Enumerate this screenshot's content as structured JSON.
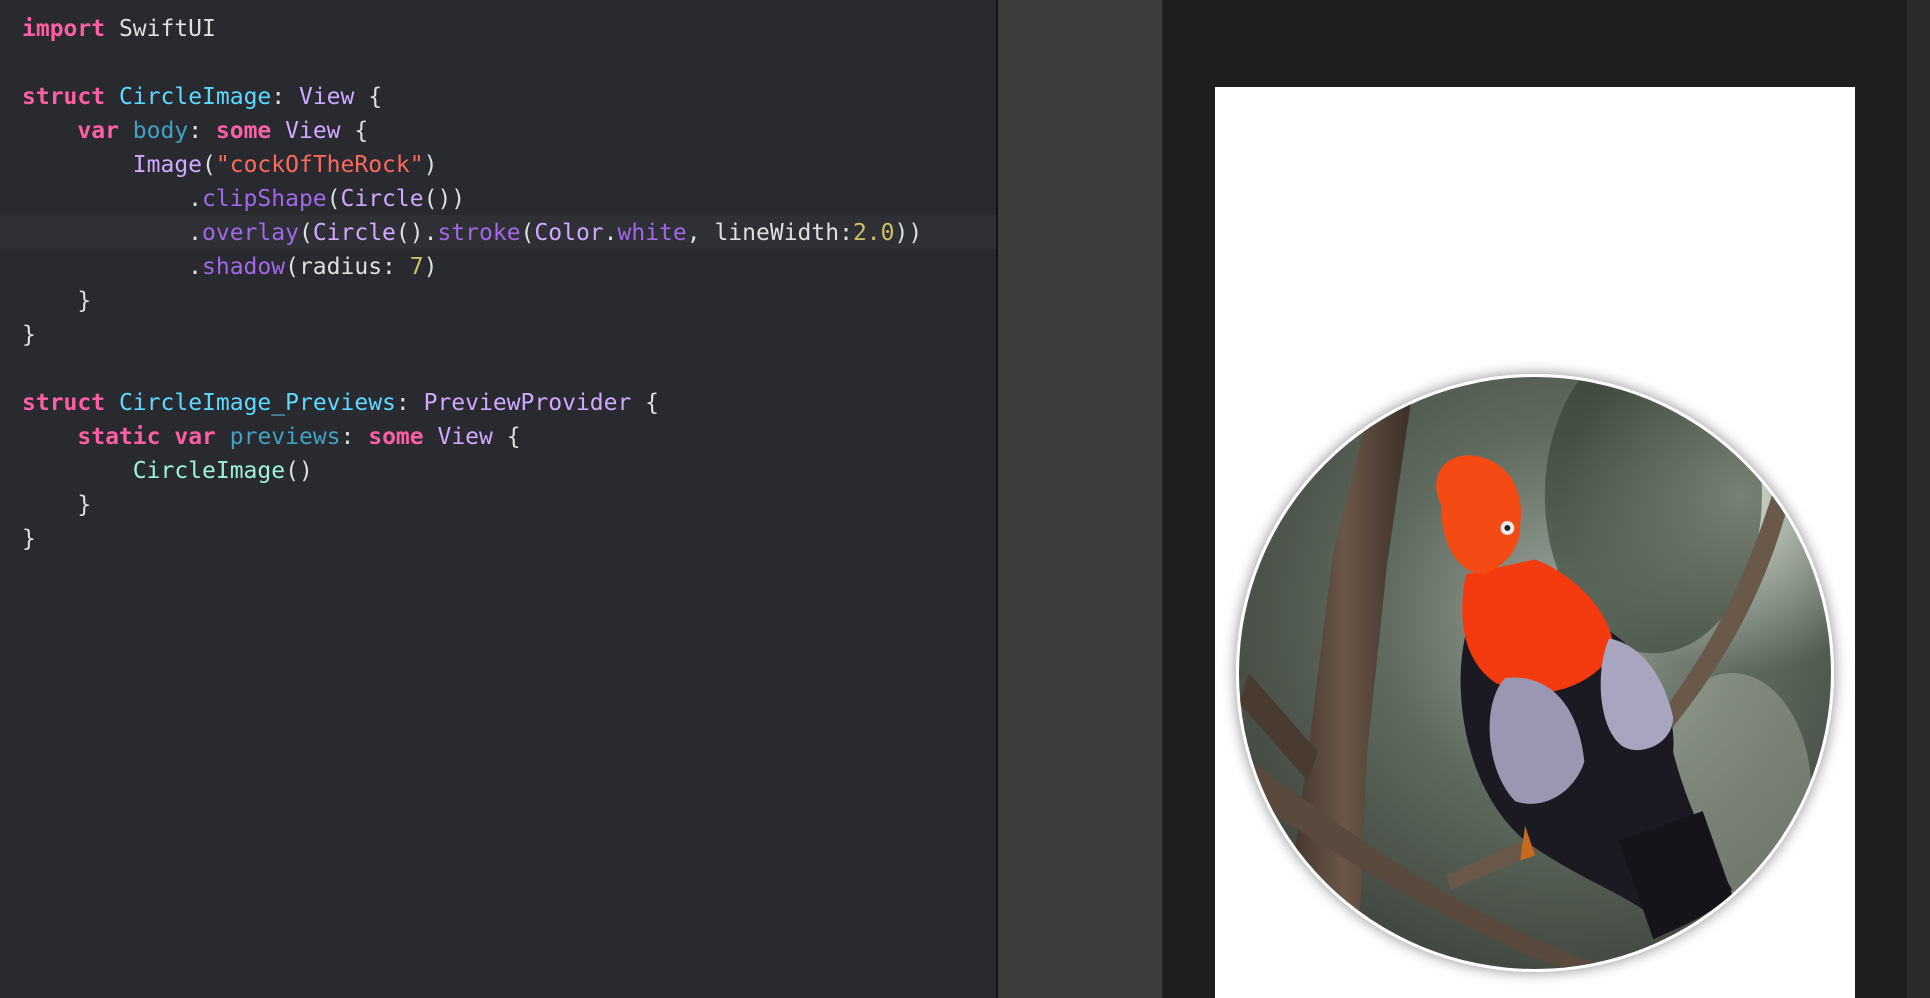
{
  "editor": {
    "lines": [
      {
        "tokens": [
          {
            "t": "import",
            "c": "kw"
          },
          {
            "t": " SwiftUI",
            "c": "ident"
          }
        ]
      },
      {
        "tokens": []
      },
      {
        "tokens": [
          {
            "t": "struct",
            "c": "kw"
          },
          {
            "t": " ",
            "c": "ident"
          },
          {
            "t": "CircleImage",
            "c": "type"
          },
          {
            "t": ": ",
            "c": "ident"
          },
          {
            "t": "View",
            "c": "builtin"
          },
          {
            "t": " {",
            "c": "ident"
          }
        ]
      },
      {
        "tokens": [
          {
            "t": "    ",
            "c": "ident"
          },
          {
            "t": "var",
            "c": "kw"
          },
          {
            "t": " ",
            "c": "ident"
          },
          {
            "t": "body",
            "c": "prop"
          },
          {
            "t": ": ",
            "c": "ident"
          },
          {
            "t": "some",
            "c": "kw"
          },
          {
            "t": " ",
            "c": "ident"
          },
          {
            "t": "View",
            "c": "builtin"
          },
          {
            "t": " {",
            "c": "ident"
          }
        ]
      },
      {
        "tokens": [
          {
            "t": "        ",
            "c": "ident"
          },
          {
            "t": "Image",
            "c": "builtin"
          },
          {
            "t": "(",
            "c": "ident"
          },
          {
            "t": "\"cockOfTheRock\"",
            "c": "str"
          },
          {
            "t": ")",
            "c": "ident"
          }
        ]
      },
      {
        "tokens": [
          {
            "t": "            .",
            "c": "ident"
          },
          {
            "t": "clipShape",
            "c": "method"
          },
          {
            "t": "(",
            "c": "ident"
          },
          {
            "t": "Circle",
            "c": "builtin"
          },
          {
            "t": "())",
            "c": "ident"
          }
        ]
      },
      {
        "tokens": [
          {
            "t": "            .",
            "c": "ident"
          },
          {
            "t": "overlay",
            "c": "method"
          },
          {
            "t": "(",
            "c": "ident"
          },
          {
            "t": "Circle",
            "c": "builtin"
          },
          {
            "t": "().",
            "c": "ident"
          },
          {
            "t": "stroke",
            "c": "method"
          },
          {
            "t": "(",
            "c": "ident"
          },
          {
            "t": "Color",
            "c": "builtin"
          },
          {
            "t": ".",
            "c": "ident"
          },
          {
            "t": "white",
            "c": "method"
          },
          {
            "t": ", lineWidth:",
            "c": "ident"
          },
          {
            "t": "2.0",
            "c": "num"
          },
          {
            "t": "))",
            "c": "ident"
          }
        ]
      },
      {
        "tokens": [
          {
            "t": "            .",
            "c": "ident"
          },
          {
            "t": "shadow",
            "c": "method"
          },
          {
            "t": "(radius: ",
            "c": "ident"
          },
          {
            "t": "7",
            "c": "num"
          },
          {
            "t": ")",
            "c": "ident"
          }
        ]
      },
      {
        "tokens": [
          {
            "t": "    }",
            "c": "ident"
          }
        ]
      },
      {
        "tokens": [
          {
            "t": "}",
            "c": "ident"
          }
        ]
      },
      {
        "tokens": []
      },
      {
        "tokens": [
          {
            "t": "struct",
            "c": "kw"
          },
          {
            "t": " ",
            "c": "ident"
          },
          {
            "t": "CircleImage_Previews",
            "c": "type"
          },
          {
            "t": ": ",
            "c": "ident"
          },
          {
            "t": "PreviewProvider",
            "c": "builtin"
          },
          {
            "t": " {",
            "c": "ident"
          }
        ]
      },
      {
        "tokens": [
          {
            "t": "    ",
            "c": "ident"
          },
          {
            "t": "static",
            "c": "kw"
          },
          {
            "t": " ",
            "c": "ident"
          },
          {
            "t": "var",
            "c": "kw"
          },
          {
            "t": " ",
            "c": "ident"
          },
          {
            "t": "previews",
            "c": "prop"
          },
          {
            "t": ": ",
            "c": "ident"
          },
          {
            "t": "some",
            "c": "kw"
          },
          {
            "t": " ",
            "c": "ident"
          },
          {
            "t": "View",
            "c": "builtin"
          },
          {
            "t": " {",
            "c": "ident"
          }
        ]
      },
      {
        "tokens": [
          {
            "t": "        ",
            "c": "ident"
          },
          {
            "t": "CircleImage",
            "c": "appcls"
          },
          {
            "t": "()",
            "c": "ident"
          }
        ]
      },
      {
        "tokens": [
          {
            "t": "    }",
            "c": "ident"
          }
        ]
      },
      {
        "tokens": [
          {
            "t": "}",
            "c": "ident"
          }
        ]
      }
    ],
    "highlighted_line": 7
  },
  "preview": {
    "image_subject": "cock-of-the-rock bird",
    "colors": {
      "canvas": "#1e1e1e",
      "device": "#ffffff",
      "circle_stroke": "#ffffff",
      "bird_orange": "#f43a0f",
      "wing_grey": "#9a97b2",
      "body_black": "#1b1a22"
    }
  }
}
